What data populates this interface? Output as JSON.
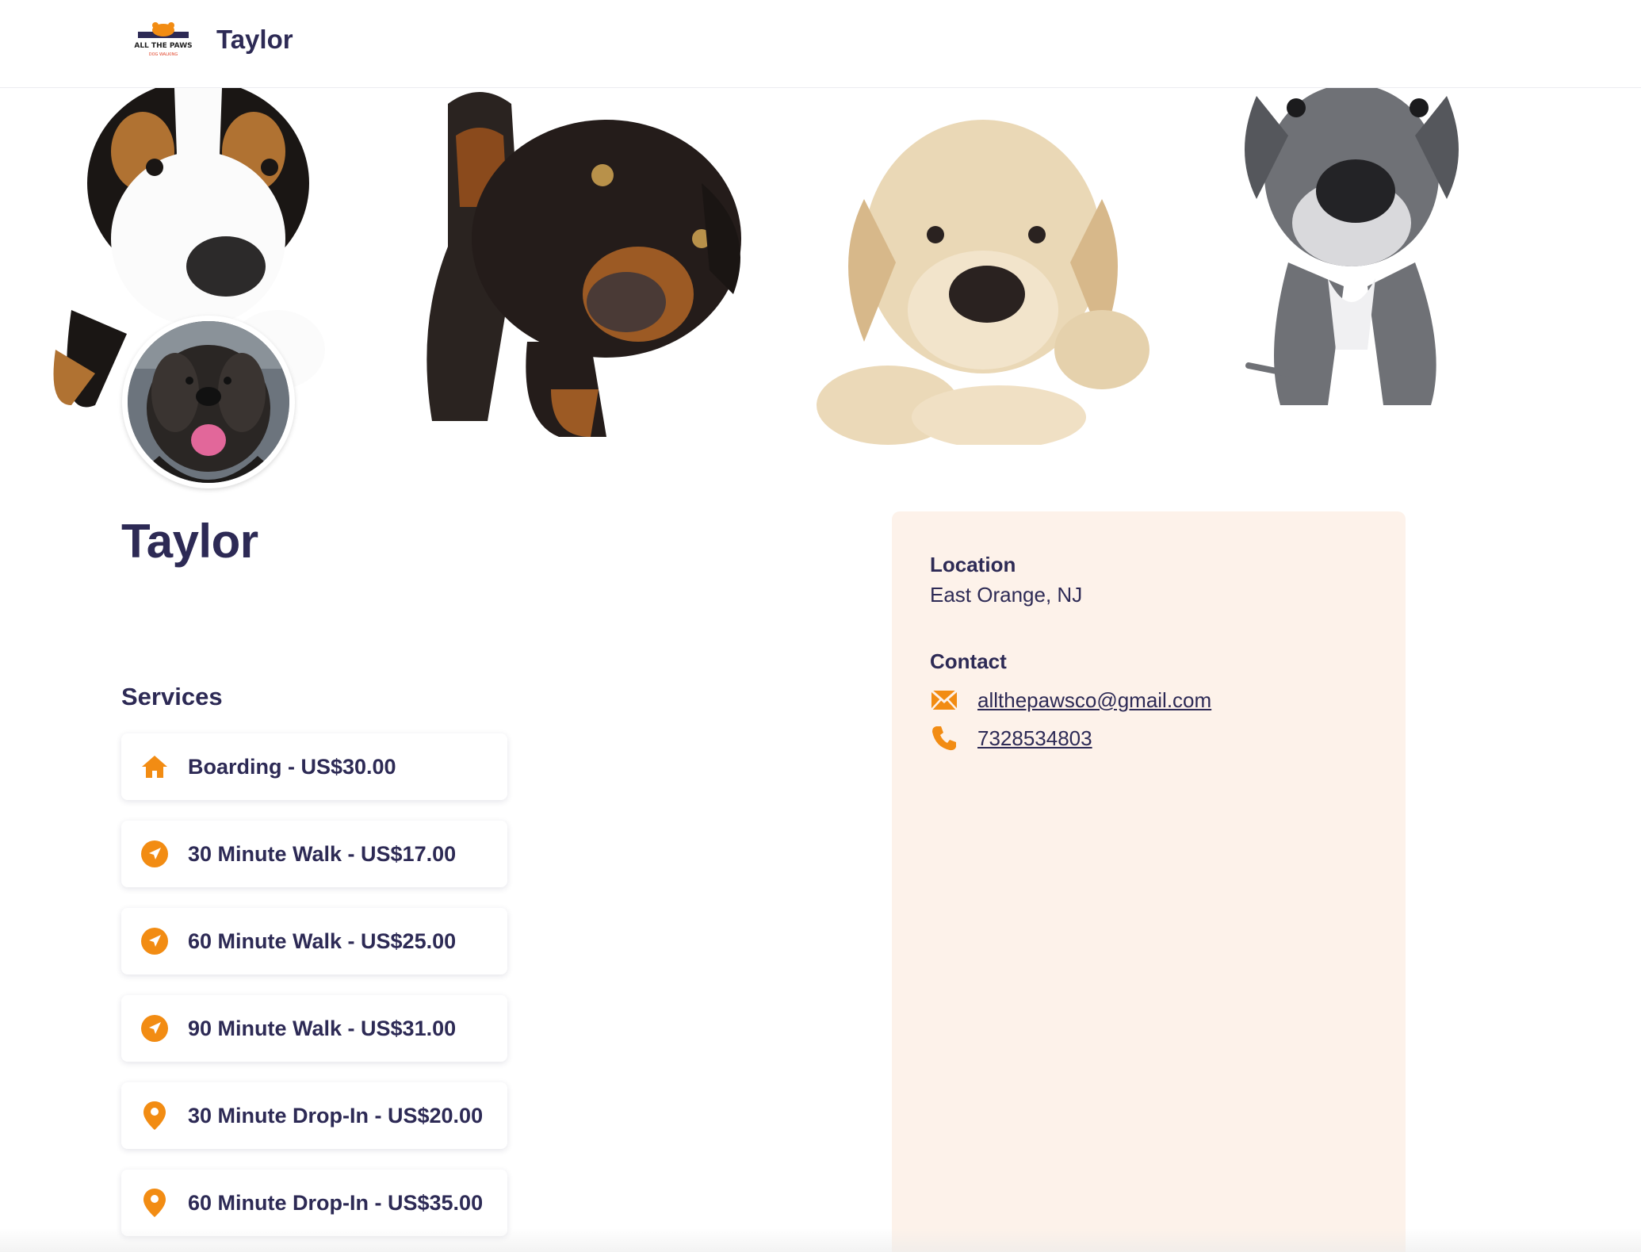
{
  "header": {
    "logo_icon": "all-the-paws-logo",
    "title": "Taylor"
  },
  "banner": {
    "image": "four-puppies-banner",
    "avatar": "dog-avatar-photo"
  },
  "profile": {
    "name": "Taylor"
  },
  "services": {
    "title": "Services",
    "items": [
      {
        "label": "Boarding - US$30.00",
        "icon": "house-icon"
      },
      {
        "label": "30 Minute Walk - US$17.00",
        "icon": "navigation-arrow-icon"
      },
      {
        "label": "60 Minute Walk - US$25.00",
        "icon": "navigation-arrow-icon"
      },
      {
        "label": "90 Minute Walk - US$31.00",
        "icon": "navigation-arrow-icon"
      },
      {
        "label": "30 Minute Drop-In - US$20.00",
        "icon": "map-pin-icon"
      },
      {
        "label": "60 Minute Drop-In - US$35.00",
        "icon": "map-pin-icon"
      }
    ]
  },
  "info": {
    "location_label": "Location",
    "location_value": "East Orange, NJ",
    "contact_label": "Contact",
    "email": "allthepawsco@gmail.com",
    "phone": "7328534803"
  },
  "colors": {
    "accent": "#f28c13",
    "text": "#2d2a55",
    "panel": "#fdf2ea"
  }
}
